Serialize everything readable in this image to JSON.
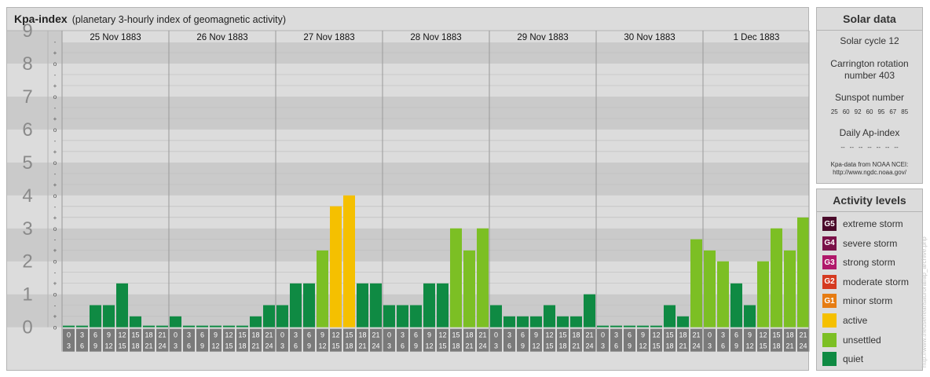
{
  "header": {
    "title": "Kpa-index",
    "subtitle": "(planetary 3-hourly index of geomagnetic activity)"
  },
  "chart_data": {
    "type": "bar",
    "title": "Kpa-index",
    "ylim": [
      0,
      9
    ],
    "y_ticks": [
      "0",
      "1",
      "2",
      "3",
      "4",
      "5",
      "6",
      "7",
      "8",
      "9"
    ],
    "minor_ticks": [
      "o",
      "+",
      "-"
    ],
    "days": [
      "25 Nov 1883",
      "26 Nov 1883",
      "27 Nov 1883",
      "28 Nov 1883",
      "29 Nov 1883",
      "30 Nov 1883",
      "1 Dec 1883"
    ],
    "interval_labels": [
      [
        "0",
        "3"
      ],
      [
        "3",
        "6"
      ],
      [
        "6",
        "9"
      ],
      [
        "9",
        "12"
      ],
      [
        "12",
        "15"
      ],
      [
        "15",
        "18"
      ],
      [
        "18",
        "21"
      ],
      [
        "21",
        "24"
      ]
    ],
    "values": [
      [
        0.0,
        0.0,
        0.67,
        0.67,
        1.33,
        0.33,
        0.0,
        0.0
      ],
      [
        0.33,
        0.0,
        0.0,
        0.0,
        0.0,
        0.0,
        0.33,
        0.67
      ],
      [
        0.67,
        1.33,
        1.33,
        2.33,
        3.67,
        4.0,
        1.33,
        1.33
      ],
      [
        0.67,
        0.67,
        0.67,
        1.33,
        1.33,
        3.0,
        2.33,
        3.0
      ],
      [
        0.67,
        0.33,
        0.33,
        0.33,
        0.67,
        0.33,
        0.33,
        1.0
      ],
      [
        0.0,
        0.0,
        0.0,
        0.0,
        0.0,
        0.67,
        0.33,
        2.67
      ],
      [
        2.33,
        2.0,
        1.33,
        0.67,
        2.0,
        3.0,
        2.33,
        3.33
      ]
    ],
    "colors": {
      "quiet": "#0f8a43",
      "unsettled": "#7cbf24",
      "active": "#f5c000",
      "band_dark": "#cacaca",
      "band_light": "#dcdcdc",
      "time_box": "#7a7a7a"
    }
  },
  "solar": {
    "title": "Solar data",
    "cycle": "Solar cycle 12",
    "carrington_line1": "Carrington rotation",
    "carrington_line2": "number 403",
    "sunspot_label": "Sunspot number",
    "sunspot_values": [
      "25",
      "60",
      "92",
      "60",
      "95",
      "67",
      "85"
    ],
    "ap_label": "Daily Ap-index",
    "ap_values": [
      "--",
      "--",
      "--",
      "--",
      "--",
      "--",
      "--"
    ],
    "source_line1": "Kpa-data from NOAA NCEI:",
    "source_line2": "http://www.ngdc.noaa.gov/"
  },
  "activity": {
    "title": "Activity levels",
    "levels": [
      {
        "badge": "G5",
        "label": "extreme storm",
        "color": "#4a0a2a"
      },
      {
        "badge": "G4",
        "label": "severe storm",
        "color": "#7a1048"
      },
      {
        "badge": "G3",
        "label": "strong storm",
        "color": "#b0186a"
      },
      {
        "badge": "G2",
        "label": "moderate storm",
        "color": "#d53a20"
      },
      {
        "badge": "G1",
        "label": "minor storm",
        "color": "#e67c12"
      },
      {
        "badge": "",
        "label": "active",
        "color": "#f5c000"
      },
      {
        "badge": "",
        "label": "unsettled",
        "color": "#7cbf24"
      },
      {
        "badge": "",
        "label": "quiet",
        "color": "#0f8a43"
      }
    ]
  },
  "watermark": "http://www.theuserlearisauroral/ap_archive.php"
}
